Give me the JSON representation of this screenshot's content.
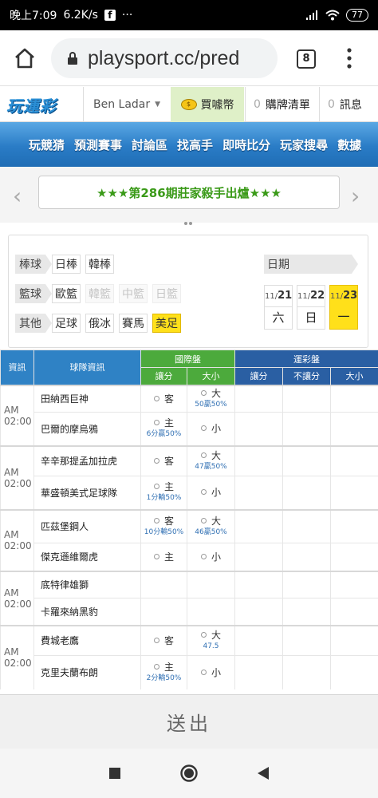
{
  "status_bar": {
    "time": "晚上7:09",
    "speed": "6.2K/s",
    "fb_icon": "f",
    "more": "···",
    "battery": "77"
  },
  "browser": {
    "url": "playsport.cc/pred",
    "tab_count": "8"
  },
  "site_header": {
    "logo": "玩運彩",
    "user_name": "Ben Ladar",
    "buy_coin": "買噱幣",
    "cart_count": "0",
    "cart_label": "購牌清單",
    "msg_count": "0",
    "msg_label": "訊息"
  },
  "nav": {
    "items": [
      "玩競猜",
      "預測賽事",
      "討論區",
      "找高手",
      "即時比分",
      "玩家搜尋",
      "數據"
    ]
  },
  "banner": {
    "text": "★★★第286期莊家殺手出爐★★★",
    "prev": "‹",
    "next": "›"
  },
  "filter": {
    "baseball_label": "棒球",
    "baseball_items": [
      "日棒",
      "韓棒"
    ],
    "basketball_label": "籃球",
    "basketball_items": [
      "歐籃",
      "韓籃",
      "中籃",
      "日籃"
    ],
    "other_label": "其他",
    "other_items": [
      "足球",
      "俄冰",
      "賽馬",
      "美足"
    ],
    "date_label": "日期",
    "dates": [
      {
        "month": "11/",
        "day": "21",
        "weekday": "六"
      },
      {
        "month": "11/",
        "day": "22",
        "weekday": "日"
      },
      {
        "month": "11/",
        "day": "23",
        "weekday": "一"
      }
    ]
  },
  "table": {
    "headers": {
      "info": "資訊",
      "team_info": "球隊資訊",
      "intl": "國際盤",
      "sports_lottery": "運彩盤",
      "spread": "讓分",
      "total": "大小",
      "no_spread": "不讓分"
    },
    "games": [
      {
        "time": "AM 02:00",
        "away": "田納西巨神",
        "home": "巴爾的摩烏鴉",
        "away_spread": "客",
        "over": "大",
        "over_sub": "50贏50%",
        "home_spread": "主",
        "home_spread_sub": "6分贏50%",
        "under": "小"
      },
      {
        "time": "AM 02:00",
        "away": "辛辛那提孟加拉虎",
        "home": "華盛頓美式足球隊",
        "away_spread": "客",
        "over": "大",
        "over_sub": "47贏50%",
        "home_spread": "主",
        "home_spread_sub": "1分輸50%",
        "under": "小"
      },
      {
        "time": "AM 02:00",
        "away": "匹茲堡鋼人",
        "home": "傑克遜維爾虎",
        "away_spread": "客",
        "away_spread_sub": "10分輸50%",
        "over": "大",
        "over_sub": "46贏50%",
        "home_spread": "主",
        "under": "小"
      },
      {
        "time": "AM 02:00",
        "away": "底特律雄獅",
        "home": "卡羅來納黑豹"
      },
      {
        "time": "AM 02:00",
        "away": "費城老鷹",
        "home": "克里夫蘭布朗",
        "away_spread": "客",
        "over": "大",
        "over_sub": "47.5",
        "home_spread": "主",
        "home_spread_sub": "2分輸50%",
        "under": "小"
      }
    ]
  },
  "submit": {
    "label": "送出"
  }
}
